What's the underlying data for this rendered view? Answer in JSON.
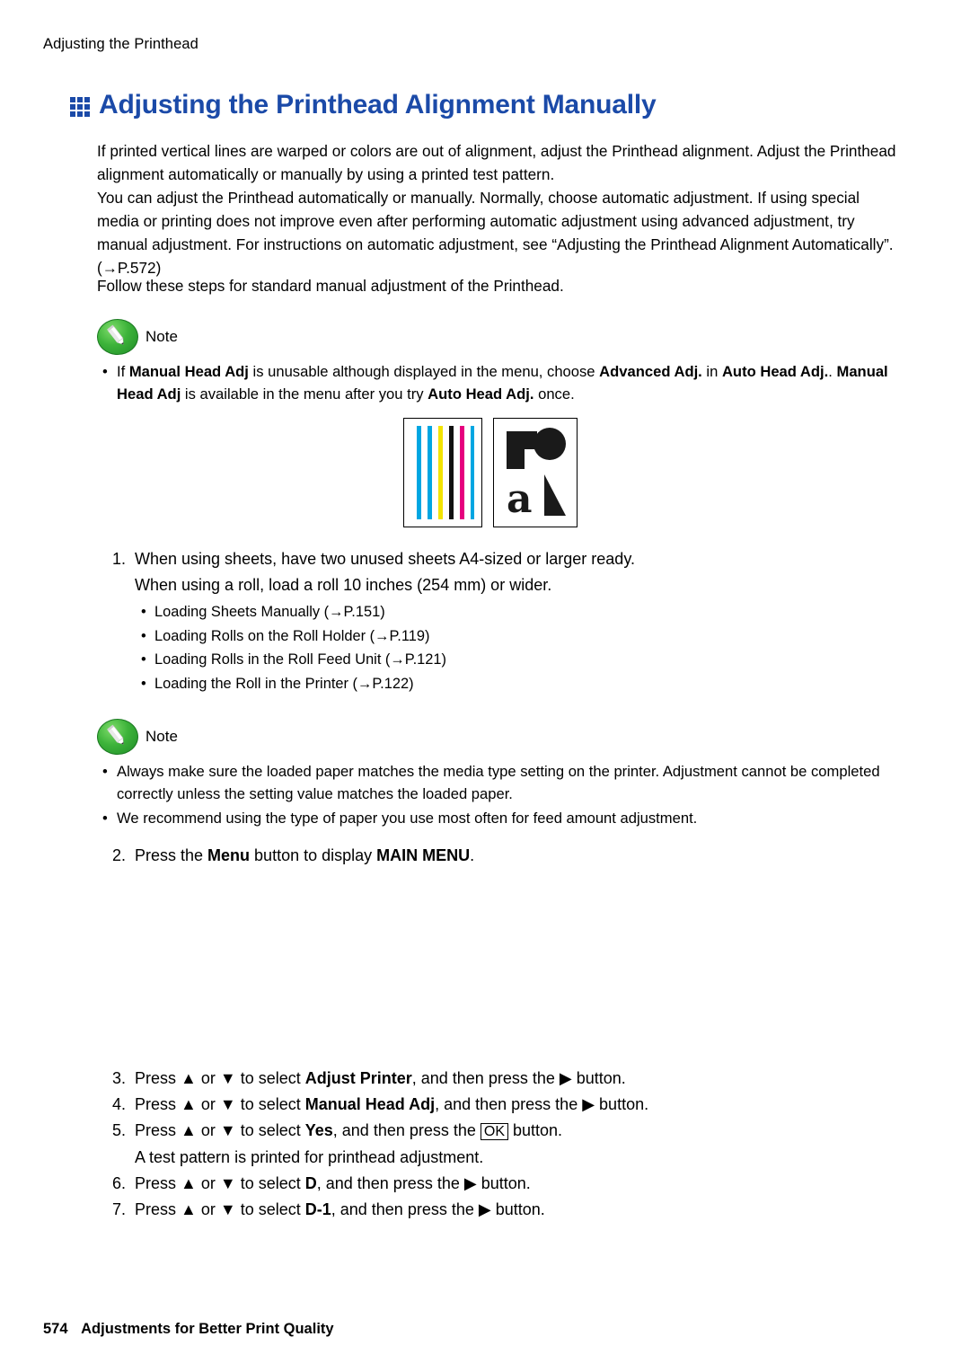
{
  "running_head": "Adjusting the Printhead",
  "title": "Adjusting the Printhead Alignment Manually",
  "paragraphs": {
    "p1": "If printed vertical lines are warped or colors are out of alignment, adjust the Printhead alignment. Adjust the Printhead alignment automatically or manually by using a printed test pattern.",
    "p2": "You can adjust the Printhead automatically or manually. Normally, choose automatic adjustment. If using special media or printing does not improve even after performing automatic adjustment using advanced adjustment, try manual adjustment. For instructions on automatic adjustment, see “Adjusting the Printhead Alignment Automatically”. (→P.572)",
    "p3": "Follow these steps for standard manual adjustment of the Printhead."
  },
  "note1": {
    "label": "Note",
    "items": [
      "If Manual Head Adj is unusable although displayed in the menu, choose Advanced Adj. in Auto Head Adj.. Manual Head Adj is available in the menu after you try Auto Head Adj. once."
    ]
  },
  "note2": {
    "label": "Note",
    "items": [
      "Always make sure the loaded paper matches the media type setting on the printer. Adjustment cannot be completed correctly unless the setting value matches the loaded paper.",
      "We recommend using the type of paper you use most often for feed amount adjustment."
    ]
  },
  "figure": {
    "name": "test-pattern-and-media-icon",
    "bar_colors": [
      "#00a6e2",
      "#00a6e2",
      "#f2e400",
      "#000000",
      "#e6007e",
      "#00a6e2"
    ],
    "icon_letter": "a"
  },
  "steps": [
    {
      "num": "1.",
      "line1": "When using sheets, have two unused sheets A4-sized or larger ready.",
      "line2": "When using a roll, load a roll 10 inches (254 mm) or wider.",
      "sub": [
        "Loading Sheets Manually (→P.151)",
        "Loading Rolls on the Roll Holder (→P.119)",
        "Loading Rolls in the Roll Feed Unit (→P.121)",
        "Loading the Roll in the Printer (→P.122)"
      ]
    },
    {
      "num": "2.",
      "text_parts": [
        "Press the ",
        "Menu",
        " button to display ",
        "MAIN MENU",
        "."
      ]
    },
    {
      "num": "3.",
      "text_parts": [
        "Press ",
        "▲",
        " or ",
        "▼",
        " to select ",
        "Adjust Printer",
        ", and then press the ",
        "▶",
        " button."
      ]
    },
    {
      "num": "4.",
      "text_parts": [
        "Press ",
        "▲",
        " or ",
        "▼",
        " to select ",
        "Manual Head Adj",
        ", and then press the ",
        "▶",
        " button."
      ]
    },
    {
      "num": "5.",
      "text_parts": [
        "Press ",
        "▲",
        " or ",
        "▼",
        " to select ",
        "Yes",
        ", and then press the ",
        "OK",
        " button."
      ],
      "follow": "A test pattern is printed for printhead adjustment."
    },
    {
      "num": "6.",
      "text_parts": [
        "Press ",
        "▲",
        " or ",
        "▼",
        " to select ",
        "D",
        ", and then press the ",
        "▶",
        " button."
      ]
    },
    {
      "num": "7.",
      "text_parts": [
        "Press ",
        "▲",
        " or ",
        "▼",
        " to select ",
        "D-1",
        ", and then press the ",
        "▶",
        " button."
      ]
    }
  ],
  "footer": {
    "page_number": "574",
    "section": "Adjustments for Better Print Quality"
  },
  "colors": {
    "title": "#1b4aa8",
    "cyan": "#00a6e2",
    "yellow": "#f2e400",
    "magenta": "#e6007e",
    "black": "#000000",
    "note_green": "#3db33a"
  }
}
